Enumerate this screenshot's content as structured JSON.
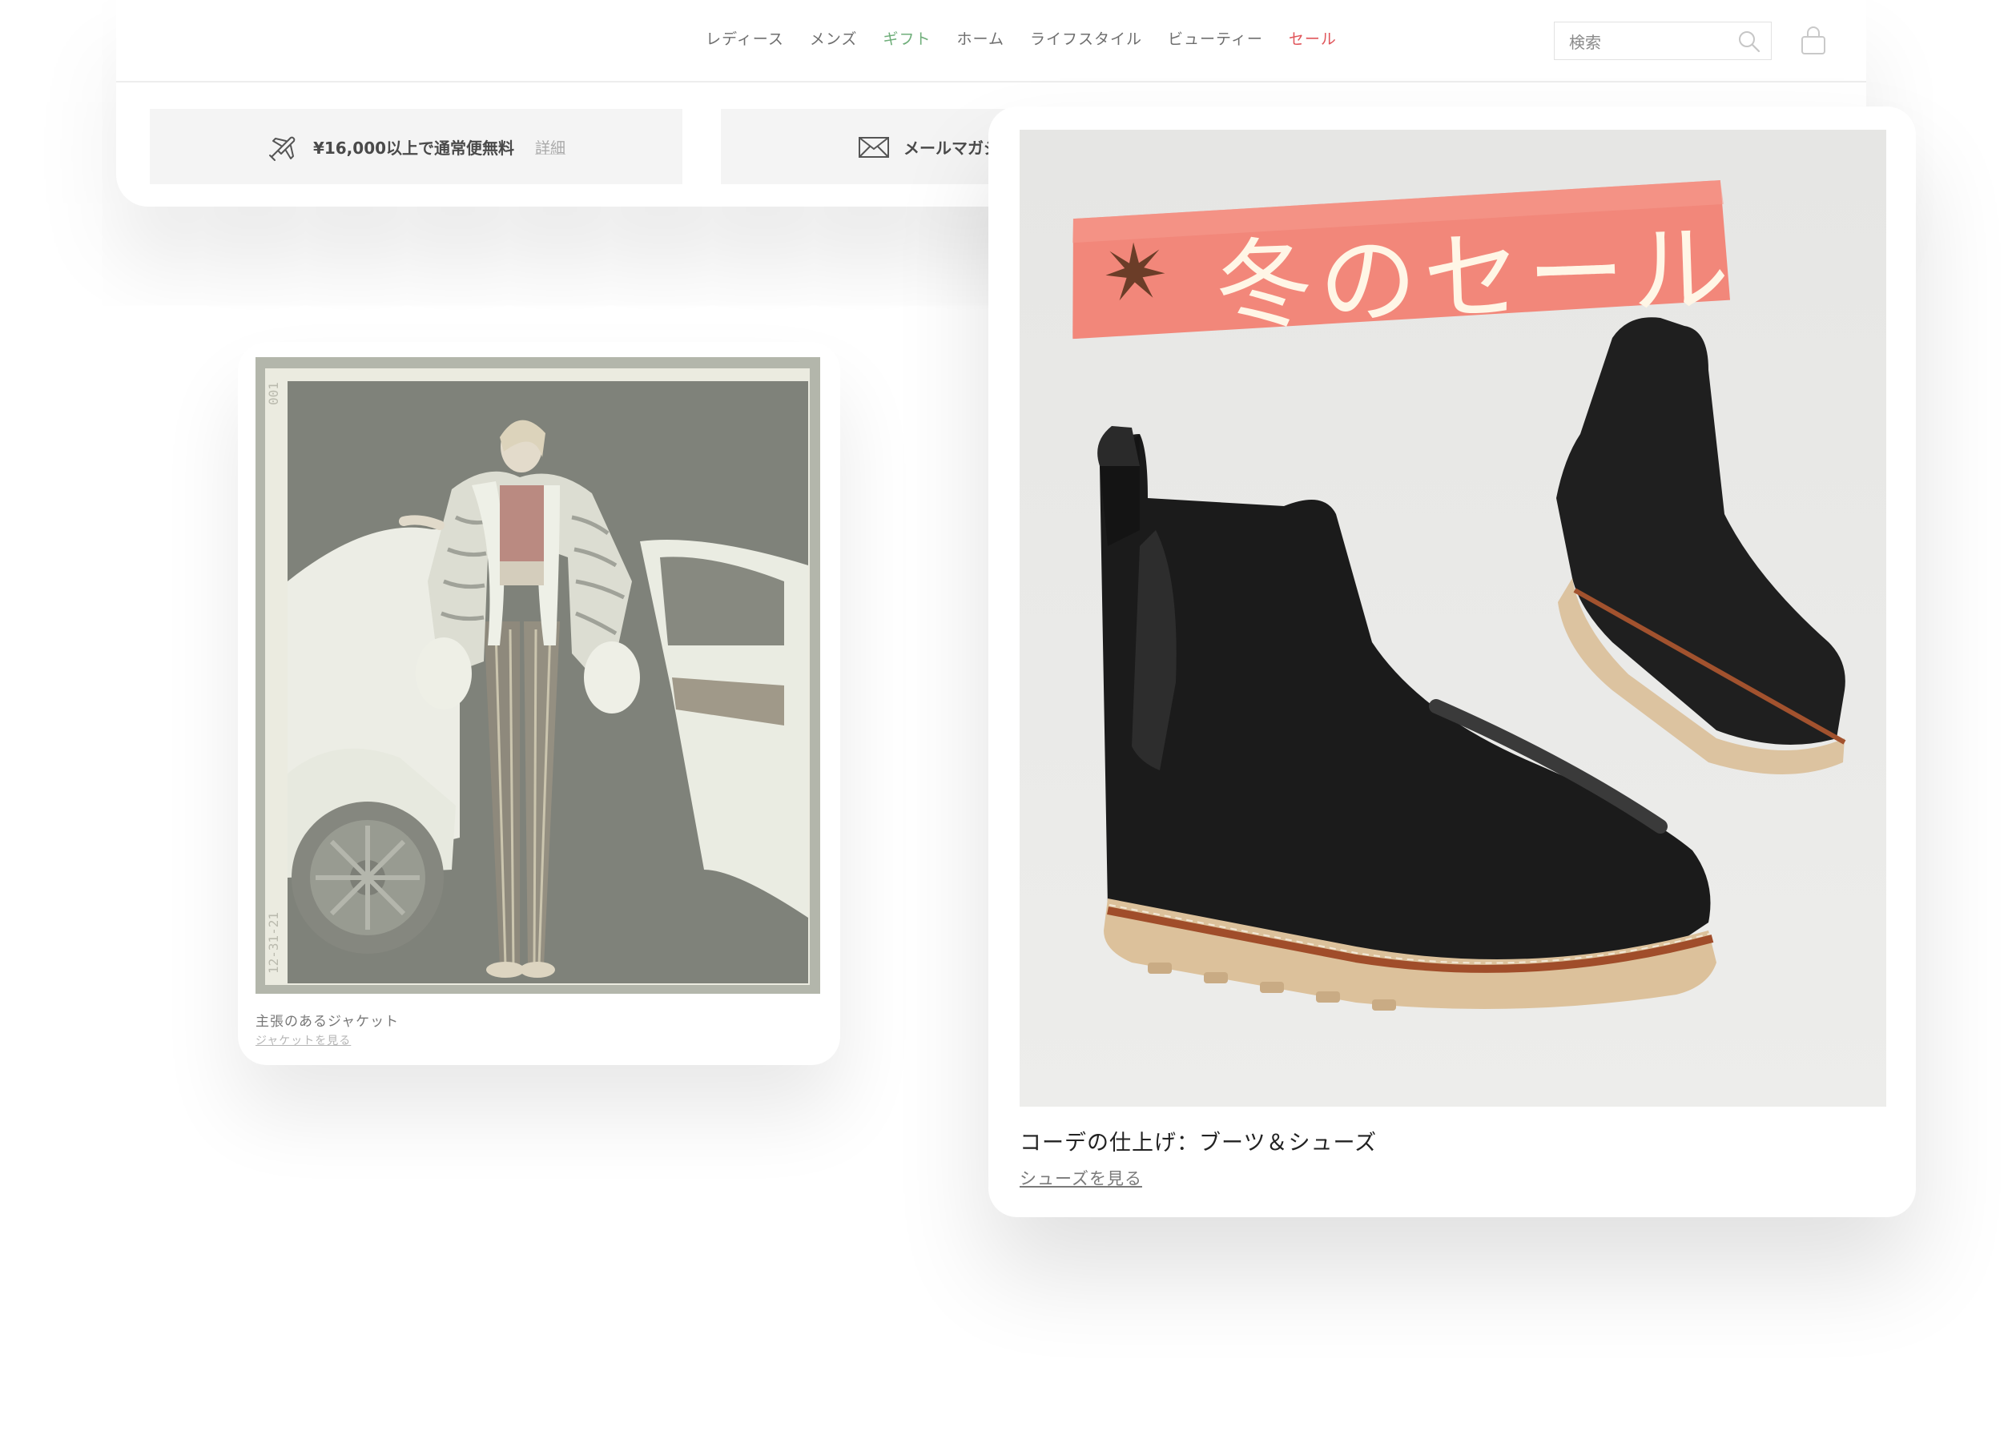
{
  "nav": {
    "items": [
      {
        "label": "レディース",
        "color": "#6e6e6e"
      },
      {
        "label": "メンズ",
        "color": "#6e6e6e"
      },
      {
        "label": "ギフト",
        "color": "#6fae7a"
      },
      {
        "label": "ホーム",
        "color": "#6e6e6e"
      },
      {
        "label": "ライフスタイル",
        "color": "#6e6e6e"
      },
      {
        "label": "ビューティー",
        "color": "#6e6e6e"
      },
      {
        "label": "セール",
        "color": "#e0555a"
      }
    ]
  },
  "search": {
    "placeholder": "検索",
    "icon": "search-icon"
  },
  "cart": {
    "icon": "shopping-bag-icon"
  },
  "promos": {
    "shipping": {
      "icon": "airplane-icon",
      "text": "¥16,000以上で通常便無料",
      "link": "詳細"
    },
    "newsletter": {
      "icon": "envelope-icon",
      "text": "メールマガジ"
    }
  },
  "card_left": {
    "title": "主張のあるジャケット",
    "link": "ジャケットを見る",
    "photo_frame_top": "001",
    "photo_frame_bottom": "12-31-21"
  },
  "card_right": {
    "banner": "冬のセール",
    "banner_color": "#f2877a",
    "title": "コーデの仕上げ：ブーツ＆シューズ",
    "link": "シューズを見る"
  }
}
